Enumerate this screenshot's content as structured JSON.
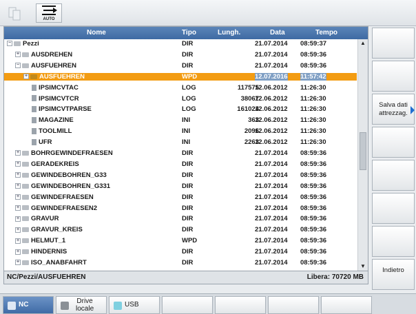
{
  "toolbar": {
    "auto_label": "AUTO"
  },
  "columns": {
    "name": "Nome",
    "type": "Tipo",
    "length": "Lungh.",
    "date": "Data",
    "time": "Tempo"
  },
  "rows": [
    {
      "name": "Pezzi",
      "type": "DIR",
      "length": "",
      "date": "21.07.2014",
      "time": "08:59:37",
      "level": 0,
      "kind": "folder",
      "pm": "−"
    },
    {
      "name": "AUSDREHEN",
      "type": "DIR",
      "length": "",
      "date": "21.07.2014",
      "time": "08:59:36",
      "level": 1,
      "kind": "folder",
      "pm": "+"
    },
    {
      "name": "AUSFUEHREN",
      "type": "DIR",
      "length": "",
      "date": "21.07.2014",
      "time": "08:59:36",
      "level": 1,
      "kind": "folder",
      "pm": "−"
    },
    {
      "name": "AUSFUEHREN",
      "type": "WPD",
      "length": "",
      "date": "12.07.2016",
      "time": "11:57:42",
      "level": 2,
      "kind": "folder-open",
      "pm": "+",
      "selected": true
    },
    {
      "name": "IPSIMCVTAC",
      "type": "LOG",
      "length": "117575",
      "date": "12.06.2012",
      "time": "11:26:30",
      "level": 3,
      "kind": "file"
    },
    {
      "name": "IPSIMCVTCR",
      "type": "LOG",
      "length": "38067",
      "date": "12.06.2012",
      "time": "11:26:30",
      "level": 3,
      "kind": "file"
    },
    {
      "name": "IPSIMCVTPARSE",
      "type": "LOG",
      "length": "161024",
      "date": "12.06.2012",
      "time": "11:26:30",
      "level": 3,
      "kind": "file"
    },
    {
      "name": "MAGAZINE",
      "type": "INI",
      "length": "363",
      "date": "12.06.2012",
      "time": "11:26:30",
      "level": 3,
      "kind": "file"
    },
    {
      "name": "TOOLMILL",
      "type": "INI",
      "length": "2096",
      "date": "12.06.2012",
      "time": "11:26:30",
      "level": 3,
      "kind": "file"
    },
    {
      "name": "UFR",
      "type": "INI",
      "length": "2263",
      "date": "12.06.2012",
      "time": "11:26:30",
      "level": 3,
      "kind": "file"
    },
    {
      "name": "BOHRGEWINDEFRAESEN",
      "type": "DIR",
      "length": "",
      "date": "21.07.2014",
      "time": "08:59:36",
      "level": 1,
      "kind": "folder",
      "pm": "+"
    },
    {
      "name": "GERADEKREIS",
      "type": "DIR",
      "length": "",
      "date": "21.07.2014",
      "time": "08:59:36",
      "level": 1,
      "kind": "folder",
      "pm": "+"
    },
    {
      "name": "GEWINDEBOHREN_G33",
      "type": "DIR",
      "length": "",
      "date": "21.07.2014",
      "time": "08:59:36",
      "level": 1,
      "kind": "folder",
      "pm": "+"
    },
    {
      "name": "GEWINDEBOHREN_G331",
      "type": "DIR",
      "length": "",
      "date": "21.07.2014",
      "time": "08:59:36",
      "level": 1,
      "kind": "folder",
      "pm": "+"
    },
    {
      "name": "GEWINDEFRAESEN",
      "type": "DIR",
      "length": "",
      "date": "21.07.2014",
      "time": "08:59:36",
      "level": 1,
      "kind": "folder",
      "pm": "+"
    },
    {
      "name": "GEWINDEFRAESEN2",
      "type": "DIR",
      "length": "",
      "date": "21.07.2014",
      "time": "08:59:36",
      "level": 1,
      "kind": "folder",
      "pm": "+"
    },
    {
      "name": "GRAVUR",
      "type": "DIR",
      "length": "",
      "date": "21.07.2014",
      "time": "08:59:36",
      "level": 1,
      "kind": "folder",
      "pm": "+"
    },
    {
      "name": "GRAVUR_KREIS",
      "type": "DIR",
      "length": "",
      "date": "21.07.2014",
      "time": "08:59:36",
      "level": 1,
      "kind": "folder",
      "pm": "+"
    },
    {
      "name": "HELMUT_1",
      "type": "WPD",
      "length": "",
      "date": "21.07.2014",
      "time": "08:59:36",
      "level": 1,
      "kind": "folder",
      "pm": "+"
    },
    {
      "name": "HINDERNIS",
      "type": "DIR",
      "length": "",
      "date": "21.07.2014",
      "time": "08:59:36",
      "level": 1,
      "kind": "folder",
      "pm": "+"
    },
    {
      "name": "ISO_ANABFAHRT",
      "type": "DIR",
      "length": "",
      "date": "21.07.2014",
      "time": "08:59:36",
      "level": 1,
      "kind": "folder",
      "pm": "+"
    }
  ],
  "status": {
    "path": "NC/Pezzi/AUSFUEHREN",
    "free": "Libera: 70720 MB"
  },
  "vertical_softkeys": [
    {
      "label": ""
    },
    {
      "label": ""
    },
    {
      "label": "Salva dati\nattrezzag.",
      "arrow": true
    },
    {
      "label": ""
    },
    {
      "label": ""
    },
    {
      "label": ""
    },
    {
      "label": ""
    },
    {
      "label": "Indietro"
    }
  ],
  "horizontal_softkeys": [
    {
      "label": "NC",
      "icon": "nc-icon",
      "active": true
    },
    {
      "label": "Drive\nlocale",
      "icon": "drive-icon"
    },
    {
      "label": "USB",
      "icon": "usb-icon"
    },
    {
      "label": ""
    },
    {
      "label": ""
    },
    {
      "label": ""
    },
    {
      "label": ""
    }
  ],
  "colors": {
    "header": "#4a77af",
    "selection": "#f39c12",
    "accent_arrow": "#1f6fd1"
  }
}
